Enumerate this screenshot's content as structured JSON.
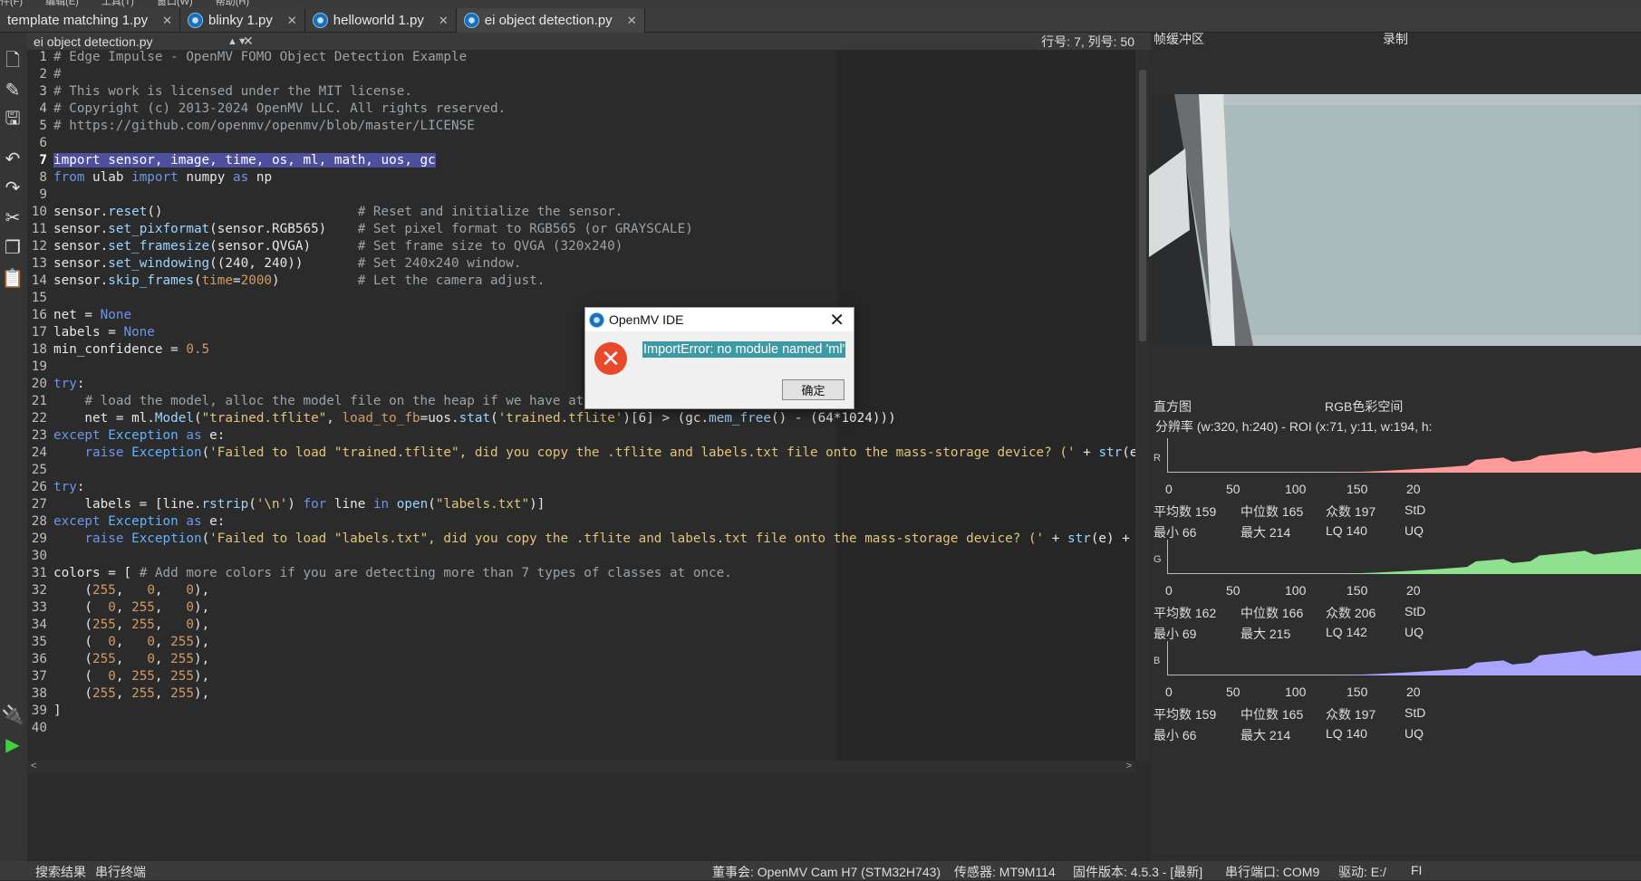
{
  "menubar": {
    "items": [
      "件(F)",
      "编辑(E)",
      "工具(T)",
      "窗口(W)",
      "帮助(H)"
    ]
  },
  "tabs": [
    {
      "label": "template matching 1.py",
      "has_icon": false,
      "active": false
    },
    {
      "label": "blinky 1.py",
      "has_icon": true,
      "active": false
    },
    {
      "label": "helloworld 1.py",
      "has_icon": true,
      "active": false
    },
    {
      "label": "ei object detection.py",
      "has_icon": true,
      "active": true
    }
  ],
  "editor": {
    "file_name": "ei object detection.py",
    "cursor_position": "行号: 7, 列号: 50",
    "current_line": 7,
    "line_numbers": [
      "1",
      "2",
      "3",
      "4",
      "5",
      "6",
      "7",
      "8",
      "9",
      "10",
      "11",
      "12",
      "13",
      "14",
      "15",
      "16",
      "17",
      "18",
      "19",
      "20",
      "21",
      "22",
      "23",
      "24",
      "25",
      "26",
      "27",
      "28",
      "29",
      "30",
      "31",
      "32",
      "33",
      "34",
      "35",
      "36",
      "37",
      "38",
      "39",
      "40"
    ]
  },
  "right_panel": {
    "framebuffer_title": "帧缓冲区",
    "record_label": "录制",
    "histogram_title": "直方图",
    "colorspace": "RGB色彩空间",
    "resolution_info": "分辨率 (w:320, h:240) - ROI (x:71, y:11, w:194, h:",
    "ticks": [
      "0",
      "50",
      "100",
      "150",
      "20"
    ],
    "channels": [
      {
        "label": "R",
        "color": "#ff9b9b",
        "mean": "平均数 159",
        "median": "中位数 165",
        "mode": "众数 197",
        "std": "StD",
        "min": "最小   66",
        "max": "最大   214",
        "lq": "LQ  140",
        "uq": "UQ"
      },
      {
        "label": "G",
        "color": "#8fe08f",
        "mean": "平均数 162",
        "median": "中位数 166",
        "mode": "众数 206",
        "std": "StD",
        "min": "最小   69",
        "max": "最大   215",
        "lq": "LQ  142",
        "uq": "UQ"
      },
      {
        "label": "B",
        "color": "#a9a4ff",
        "mean": "平均数 159",
        "median": "中位数 165",
        "mode": "众数 197",
        "std": "StD",
        "min": "最小   66",
        "max": "最大   214",
        "lq": "LQ  140",
        "uq": "UQ"
      }
    ]
  },
  "dialog": {
    "title": "OpenMV IDE",
    "message": "ImportError: no module named 'ml'",
    "ok_label": "确定"
  },
  "status": {
    "search_results": "搜索结果",
    "serial_terminal": "串行终端",
    "board": "董事会: OpenMV Cam H7 (STM32H743)",
    "sensor": "传感器: MT9M114",
    "firmware": "固件版本: 4.5.3 - [最新]",
    "port": "串行端口: COM9",
    "drive": "驱动: E:/",
    "fps": "FI"
  },
  "colors": {
    "accent": "#4e4f9e",
    "error": "#e8492a"
  }
}
